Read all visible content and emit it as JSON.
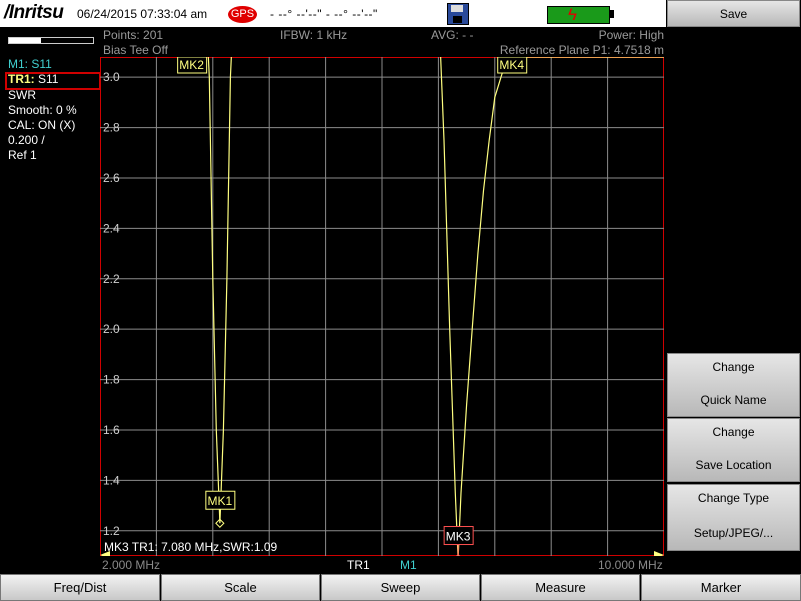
{
  "status_bar": {
    "brand": "/Inritsu",
    "datetime": "06/24/2015  07:33:04 am",
    "gps_label": "GPS",
    "gps_coords": "- --° --'--\" - --° --'--\""
  },
  "header": {
    "points": "Points: 201",
    "bias_tee": "Bias Tee Off",
    "ifbw": "IFBW: 1 kHz",
    "avg": "AVG: - -",
    "power": "Power: High",
    "ref_plane": "Reference Plane P1: 4.7518 m"
  },
  "left_panel": {
    "m1": "M1: S11",
    "tr1_prefix": "TR1:",
    "tr1_value": " S11",
    "format": "SWR",
    "smooth": "Smooth: 0 %",
    "cal": "CAL: ON (X)",
    "scale": "0.200 /",
    "ref": "Ref 1",
    "signal_level": 0.38
  },
  "chart_data": {
    "type": "line",
    "x_unit": "MHz",
    "xlim": [
      2.0,
      10.0
    ],
    "ylim": [
      1.1,
      3.08
    ],
    "ytick_values": [
      1.2,
      1.4,
      1.6,
      1.8,
      2.0,
      2.2,
      2.4,
      2.6,
      2.8,
      3.0
    ],
    "ytick_labels": [
      "1.2",
      "1.4",
      "1.6",
      "1.8",
      "2.0",
      "2.2",
      "2.4",
      "2.6",
      "2.8",
      "3.0"
    ],
    "x_grid_count": 10,
    "xstart_label": "2.000 MHz",
    "xstop_label": "10.000 MHz",
    "grid": true,
    "trace_color": "#ffff80",
    "series": [
      {
        "x": [
          2.0,
          3.5,
          3.55,
          3.6,
          3.65,
          3.7,
          3.75,
          3.8,
          3.85,
          3.9,
          6.8,
          6.88,
          6.96,
          7.04,
          7.08,
          7.12,
          7.2,
          7.28,
          7.36,
          7.44,
          7.52,
          7.6,
          7.72,
          7.84,
          10.0
        ],
        "y": [
          3.3,
          3.3,
          3.0,
          2.2,
          1.6,
          1.23,
          1.6,
          2.2,
          3.0,
          3.3,
          3.3,
          2.75,
          2.0,
          1.35,
          1.09,
          1.35,
          1.7,
          2.0,
          2.3,
          2.55,
          2.75,
          2.92,
          3.03,
          3.08,
          3.08
        ]
      }
    ],
    "markers": [
      {
        "label": "MK1",
        "x": 3.7,
        "y": 1.23,
        "color": "#ffff80"
      },
      {
        "label": "MK2",
        "x": 3.3,
        "y": 3.08,
        "color": "#ffff80"
      },
      {
        "label": "MK3",
        "x": 7.08,
        "y": 1.09,
        "color": "#ff5050"
      },
      {
        "label": "MK4",
        "x": 7.84,
        "y": 3.08,
        "color": "#ffff80"
      }
    ],
    "marker_readout": "MK3 TR1:  7.080 MHz,SWR:1.09",
    "trace_label": "TR1",
    "marker_ref_label": "M1"
  },
  "softkeys": {
    "save": "Save",
    "change_name_1": "Change",
    "change_name_2": "Quick Name",
    "change_loc_1": "Change",
    "change_loc_2": "Save Location",
    "change_type_1": "Change Type",
    "change_type_2": "Setup/JPEG/..."
  },
  "bottom_menu": [
    "Freq/Dist",
    "Scale",
    "Sweep",
    "Measure",
    "Marker"
  ]
}
